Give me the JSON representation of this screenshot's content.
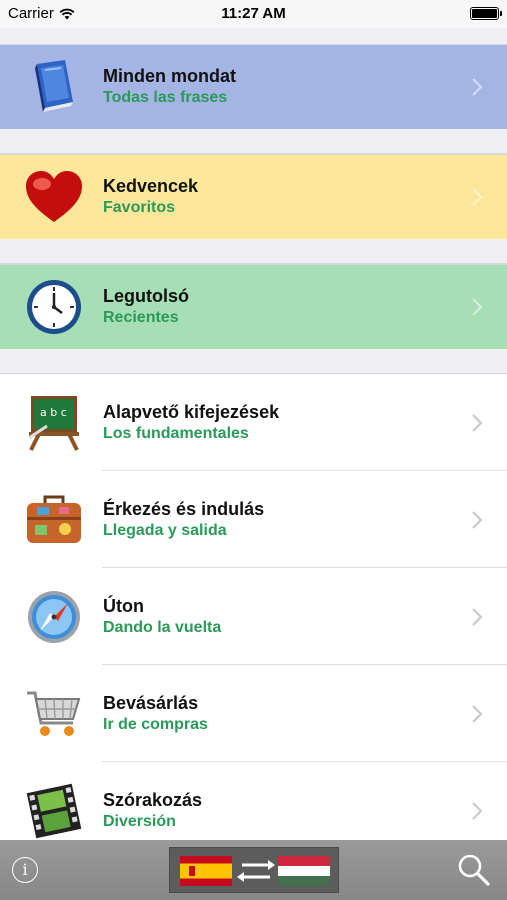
{
  "status_bar": {
    "carrier": "Carrier",
    "time": "11:27 AM"
  },
  "categories": [
    {
      "title": "Minden mondat",
      "subtitle": "Todas las frases",
      "icon": "book-icon",
      "background": "#a4b4e4"
    },
    {
      "title": "Kedvencek",
      "subtitle": "Favoritos",
      "icon": "heart-icon",
      "background": "#fde79a"
    },
    {
      "title": "Legutolsó",
      "subtitle": "Recientes",
      "icon": "clock-icon",
      "background": "#a6deb6"
    },
    {
      "title": "Alapvető kifejezések",
      "subtitle": "Los fundamentales",
      "icon": "chalkboard-icon",
      "background": "#ffffff"
    },
    {
      "title": "Érkezés és indulás",
      "subtitle": "Llegada y salida",
      "icon": "suitcase-icon",
      "background": "#ffffff"
    },
    {
      "title": "Úton",
      "subtitle": "Dando la vuelta",
      "icon": "compass-icon",
      "background": "#ffffff"
    },
    {
      "title": "Bevásárlás",
      "subtitle": "Ir de compras",
      "icon": "shopping-cart-icon",
      "background": "#ffffff"
    },
    {
      "title": "Szórakozás",
      "subtitle": "Diversión",
      "icon": "film-strip-icon",
      "background": "#ffffff"
    }
  ],
  "toolbar": {
    "info_icon": "info-icon",
    "info_glyph": "i",
    "language_switch": {
      "from": "spain-flag-icon",
      "to": "hungary-flag-icon",
      "swap": "swap-arrows-icon"
    },
    "search_icon": "search-icon"
  },
  "colors": {
    "subtitle": "#2a9a58",
    "background": "#efeff4",
    "toolbar": "#909090"
  }
}
